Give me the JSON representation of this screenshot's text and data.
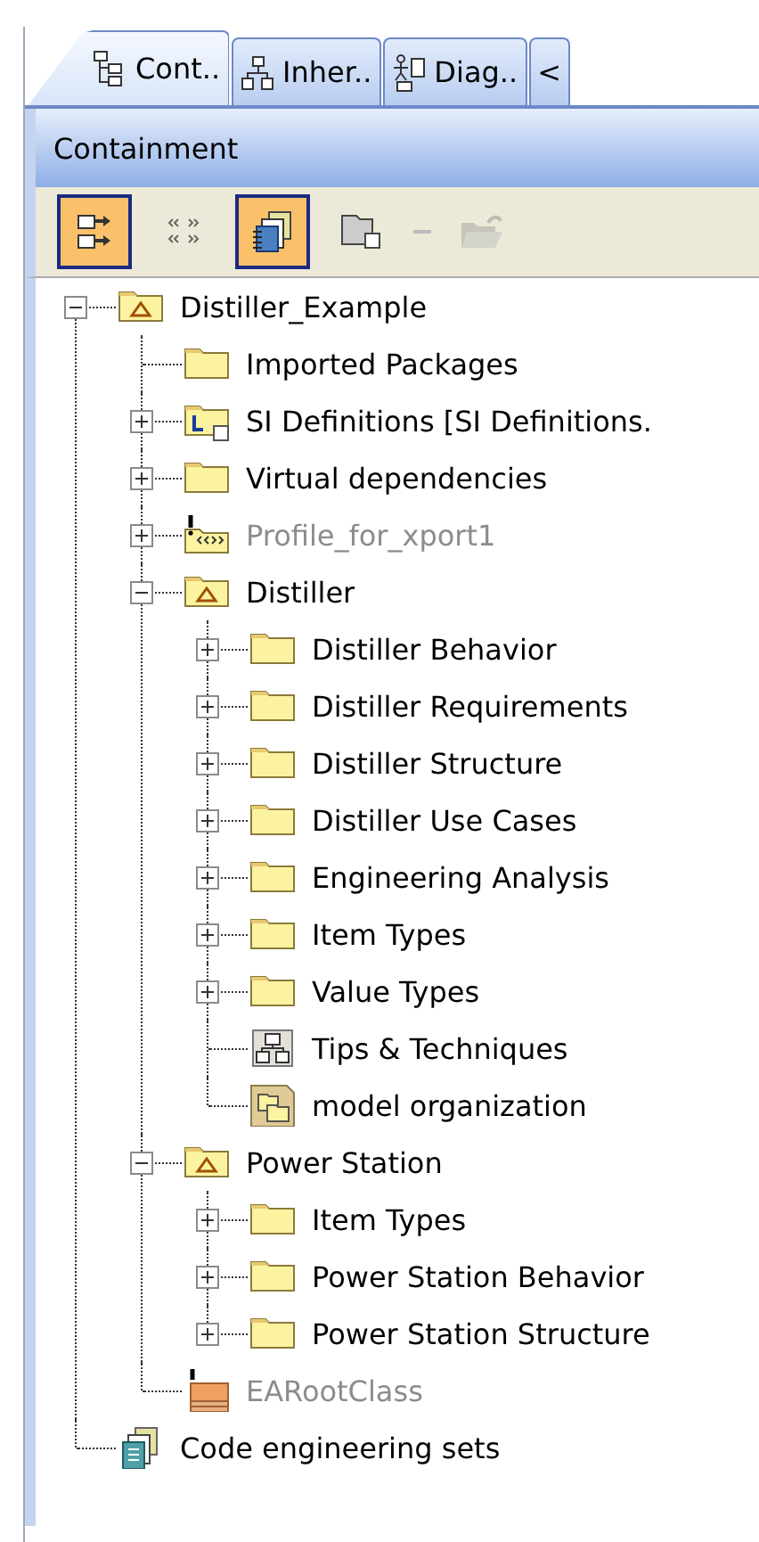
{
  "tabs": [
    {
      "label": "Cont..",
      "kind": "containment",
      "selected": true
    },
    {
      "label": "Inher..",
      "kind": "inheritance",
      "selected": false
    },
    {
      "label": "Diag..",
      "kind": "diagrams",
      "selected": false
    },
    {
      "label": "<",
      "kind": "stereotype",
      "selected": false
    }
  ],
  "panel": {
    "title": "Containment"
  },
  "toolbar": [
    {
      "kind": "sort",
      "selected": true,
      "disabled": false
    },
    {
      "kind": "stereotypes",
      "selected": false,
      "disabled": false
    },
    {
      "kind": "documents",
      "selected": true,
      "disabled": false
    },
    {
      "kind": "collapse",
      "selected": false,
      "disabled": false
    },
    {
      "kind": "separator"
    },
    {
      "kind": "open",
      "selected": false,
      "disabled": true
    }
  ],
  "tree": [
    {
      "label": "Distiller_Example",
      "kind": "model",
      "expanded": true,
      "dimmed": false,
      "children": [
        {
          "label": "Imported Packages",
          "kind": "folder",
          "dimmed": false
        },
        {
          "label": "SI Definitions [SI Definitions.",
          "kind": "library",
          "expanded": false,
          "dimmed": false
        },
        {
          "label": "Virtual dependencies",
          "kind": "folder",
          "expanded": false,
          "dimmed": false
        },
        {
          "label": "Profile_for_xport1",
          "kind": "profile",
          "expanded": false,
          "dimmed": true
        },
        {
          "label": "Distiller",
          "kind": "model",
          "expanded": true,
          "dimmed": false,
          "children": [
            {
              "label": "Distiller Behavior",
              "kind": "folder",
              "expanded": false,
              "dimmed": false
            },
            {
              "label": "Distiller Requirements",
              "kind": "folder",
              "expanded": false,
              "dimmed": false
            },
            {
              "label": "Distiller Structure",
              "kind": "folder",
              "expanded": false,
              "dimmed": false
            },
            {
              "label": "Distiller Use Cases",
              "kind": "folder",
              "expanded": false,
              "dimmed": false
            },
            {
              "label": "Engineering Analysis",
              "kind": "folder",
              "expanded": false,
              "dimmed": false
            },
            {
              "label": "Item Types",
              "kind": "folder",
              "expanded": false,
              "dimmed": false
            },
            {
              "label": "Value Types",
              "kind": "folder",
              "expanded": false,
              "dimmed": false
            },
            {
              "label": "Tips & Techniques",
              "kind": "diagram",
              "dimmed": false
            },
            {
              "label": "model organization",
              "kind": "package-diagram",
              "dimmed": false
            }
          ]
        },
        {
          "label": "Power Station",
          "kind": "model",
          "expanded": true,
          "dimmed": false,
          "children": [
            {
              "label": "Item Types",
              "kind": "folder",
              "expanded": false,
              "dimmed": false
            },
            {
              "label": "Power Station Behavior",
              "kind": "folder",
              "expanded": false,
              "dimmed": false
            },
            {
              "label": "Power Station Structure",
              "kind": "folder",
              "expanded": false,
              "dimmed": false
            }
          ]
        },
        {
          "label": "EARootClass",
          "kind": "class",
          "dimmed": true
        }
      ]
    },
    {
      "label": "Code engineering sets",
      "kind": "code-sets",
      "dimmed": false
    }
  ]
}
